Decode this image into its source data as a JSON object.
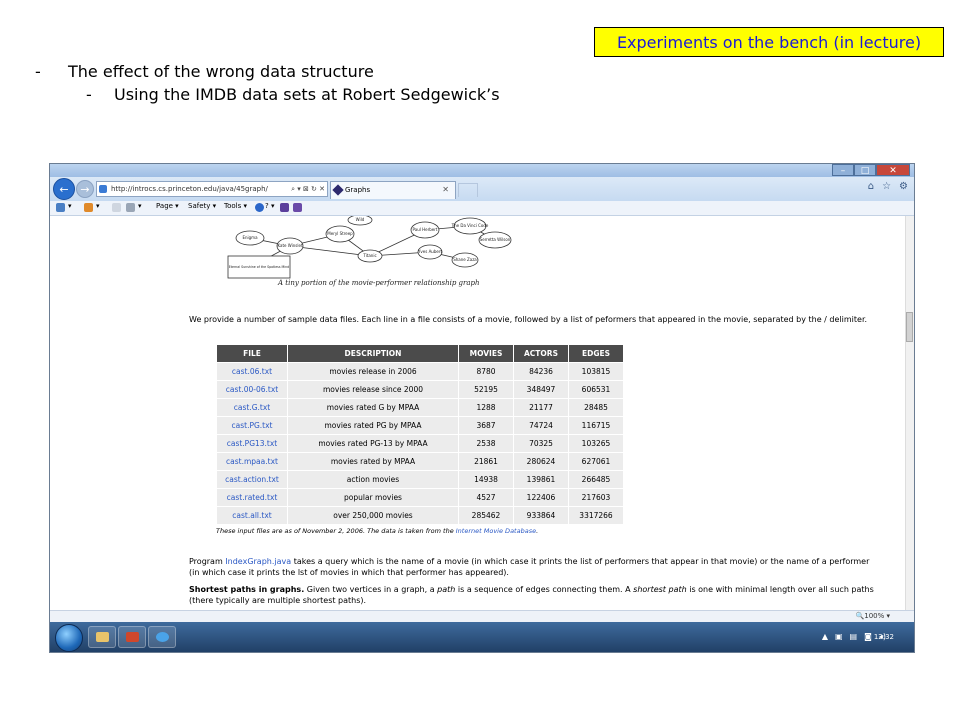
{
  "slide": {
    "callout": "Experiments on the bench (in lecture)",
    "bullet1_dash": "-",
    "bullet1": "The effect of the wrong data structure",
    "bullet2_dash": "-",
    "bullet2": "Using the IMDB data sets at Robert Sedgewick’s"
  },
  "browser": {
    "window_buttons": {
      "minimize": "–",
      "maximize": "□",
      "close": "✕"
    },
    "back_glyph": "←",
    "forward_glyph": "→",
    "url": "http://introcs.cs.princeton.edu/java/45graph/",
    "address_controls": "⌕ ▾ ⊠ ↻ ✕",
    "tab_title": "Graphs",
    "tab_close": "✕",
    "nav_right_icons": [
      "⌂",
      "☆",
      "⚙"
    ],
    "command_bar": {
      "page_label": "Page ▾",
      "safety_label": "Safety ▾",
      "tools_label": "Tools ▾",
      "help_label": "? ▾",
      "small_glyphs": [
        "▾",
        "▾",
        "▾"
      ]
    },
    "zoom": "🔍100% ▾",
    "clock": "12:32",
    "tray_icons": [
      "▲",
      "▣",
      "▤",
      "◙",
      "◂)"
    ]
  },
  "page": {
    "graph_nodes": [
      "Kate Winslet",
      "Meryl Streep",
      "Paul Herbert",
      "The Da Vinci Code",
      "Serretta Wilson",
      "Titanic",
      "Yves Aubert",
      "Shane Zaza",
      "Eternal Sunshine of the Spotless Mind",
      "Enigma",
      "Wild"
    ],
    "graph_caption": "A tiny portion of the movie-performer relationship graph",
    "intro": "We provide a number of sample data files. Each line in a file consists of a movie, followed by a list of peformers that appeared in the movie, separated by the / delimiter.",
    "table": {
      "headers": [
        "FILE",
        "DESCRIPTION",
        "MOVIES",
        "ACTORS",
        "EDGES"
      ],
      "rows": [
        [
          "cast.06.txt",
          "movies release in 2006",
          "8780",
          "84236",
          "103815"
        ],
        [
          "cast.00-06.txt",
          "movies release since 2000",
          "52195",
          "348497",
          "606531"
        ],
        [
          "cast.G.txt",
          "movies rated G by MPAA",
          "1288",
          "21177",
          "28485"
        ],
        [
          "cast.PG.txt",
          "movies rated PG by MPAA",
          "3687",
          "74724",
          "116715"
        ],
        [
          "cast.PG13.txt",
          "movies rated PG-13 by MPAA",
          "2538",
          "70325",
          "103265"
        ],
        [
          "cast.mpaa.txt",
          "movies rated by MPAA",
          "21861",
          "280624",
          "627061"
        ],
        [
          "cast.action.txt",
          "action movies",
          "14938",
          "139861",
          "266485"
        ],
        [
          "cast.rated.txt",
          "popular movies",
          "4527",
          "122406",
          "217603"
        ],
        [
          "cast.all.txt",
          "over 250,000 movies",
          "285462",
          "933864",
          "3317266"
        ]
      ]
    },
    "note_prefix": "These input files are as of November 2, 2006. The data is taken from the ",
    "note_link": "Internet Movie Database",
    "note_suffix": ".",
    "program_prefix": "Program ",
    "program_link": "IndexGraph.java",
    "program_text": " takes a query which is the name of a movie (in which case it prints the list of performers that appear in that movie) or the name of a performer (in which case it prints the lst of movies in which that performer has appeared).",
    "sp_title": "Shortest paths in graphs.",
    "sp_text1": " Given two vertices in a graph, a ",
    "sp_path": "path",
    "sp_text2": " is a sequence of edges connecting them. A ",
    "sp_shortest": "shortest path",
    "sp_text3": " is one with minimal length over all such paths (there typically are multiple shortest paths)."
  },
  "colors": {
    "callout_bg": "#ffff00",
    "callout_text": "#1a1ad8",
    "link": "#2a58c4",
    "table_header": "#4b4b4b"
  }
}
